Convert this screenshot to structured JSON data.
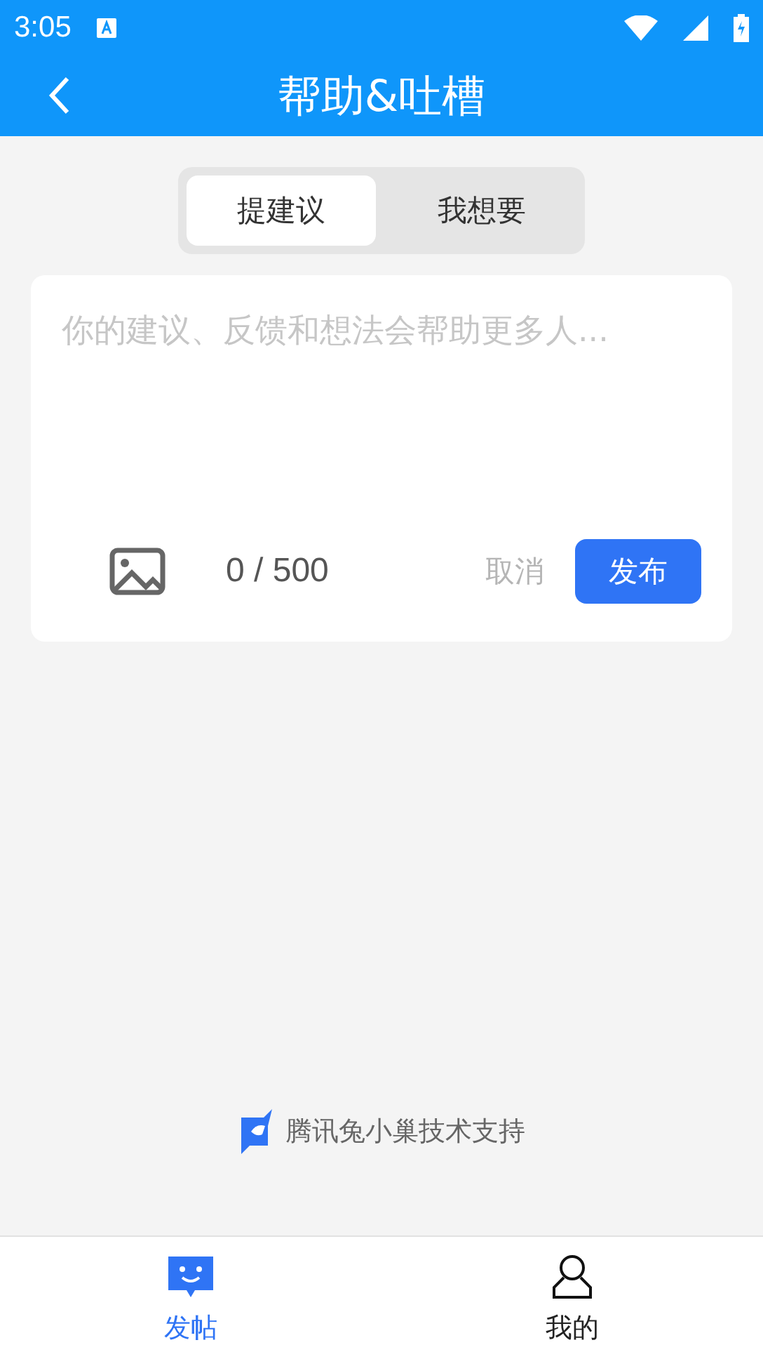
{
  "status_bar": {
    "time": "3:05"
  },
  "header": {
    "title": "帮助&吐槽"
  },
  "tabs": [
    {
      "label": "提建议",
      "selected": true
    },
    {
      "label": "我想要",
      "selected": false
    }
  ],
  "post_box": {
    "placeholder": "你的建议、反馈和想法会帮助更多人...",
    "counter": "0 / 500",
    "cancel": "取消",
    "publish": "发布"
  },
  "footer": {
    "text": "腾讯兔小巢技术支持"
  },
  "bottom_nav": [
    {
      "label": "发帖",
      "kind": "post",
      "selected": true
    },
    {
      "label": "我的",
      "kind": "profile",
      "selected": false
    }
  ]
}
